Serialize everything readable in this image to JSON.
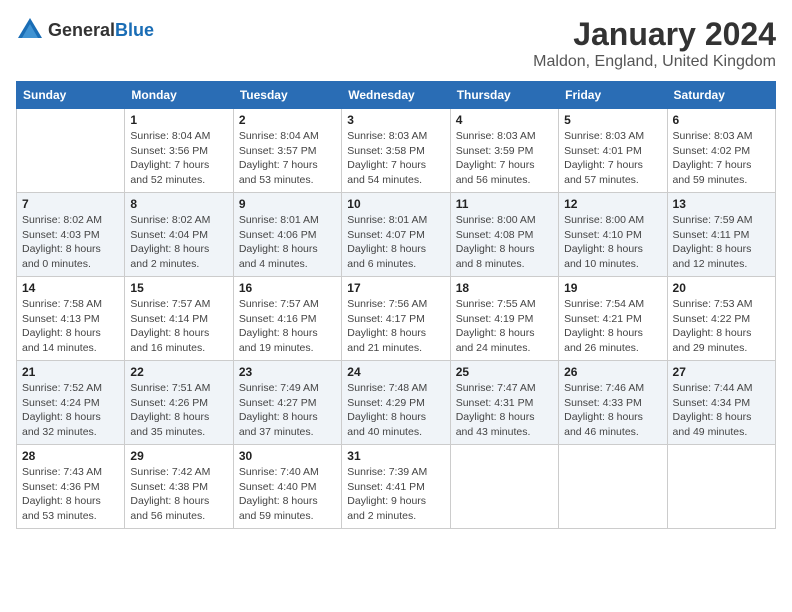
{
  "logo": {
    "general": "General",
    "blue": "Blue"
  },
  "title": "January 2024",
  "location": "Maldon, England, United Kingdom",
  "headers": [
    "Sunday",
    "Monday",
    "Tuesday",
    "Wednesday",
    "Thursday",
    "Friday",
    "Saturday"
  ],
  "rows": [
    {
      "shaded": false,
      "cells": [
        {
          "day": "",
          "lines": []
        },
        {
          "day": "1",
          "lines": [
            "Sunrise: 8:04 AM",
            "Sunset: 3:56 PM",
            "Daylight: 7 hours",
            "and 52 minutes."
          ]
        },
        {
          "day": "2",
          "lines": [
            "Sunrise: 8:04 AM",
            "Sunset: 3:57 PM",
            "Daylight: 7 hours",
            "and 53 minutes."
          ]
        },
        {
          "day": "3",
          "lines": [
            "Sunrise: 8:03 AM",
            "Sunset: 3:58 PM",
            "Daylight: 7 hours",
            "and 54 minutes."
          ]
        },
        {
          "day": "4",
          "lines": [
            "Sunrise: 8:03 AM",
            "Sunset: 3:59 PM",
            "Daylight: 7 hours",
            "and 56 minutes."
          ]
        },
        {
          "day": "5",
          "lines": [
            "Sunrise: 8:03 AM",
            "Sunset: 4:01 PM",
            "Daylight: 7 hours",
            "and 57 minutes."
          ]
        },
        {
          "day": "6",
          "lines": [
            "Sunrise: 8:03 AM",
            "Sunset: 4:02 PM",
            "Daylight: 7 hours",
            "and 59 minutes."
          ]
        }
      ]
    },
    {
      "shaded": true,
      "cells": [
        {
          "day": "7",
          "lines": [
            "Sunrise: 8:02 AM",
            "Sunset: 4:03 PM",
            "Daylight: 8 hours",
            "and 0 minutes."
          ]
        },
        {
          "day": "8",
          "lines": [
            "Sunrise: 8:02 AM",
            "Sunset: 4:04 PM",
            "Daylight: 8 hours",
            "and 2 minutes."
          ]
        },
        {
          "day": "9",
          "lines": [
            "Sunrise: 8:01 AM",
            "Sunset: 4:06 PM",
            "Daylight: 8 hours",
            "and 4 minutes."
          ]
        },
        {
          "day": "10",
          "lines": [
            "Sunrise: 8:01 AM",
            "Sunset: 4:07 PM",
            "Daylight: 8 hours",
            "and 6 minutes."
          ]
        },
        {
          "day": "11",
          "lines": [
            "Sunrise: 8:00 AM",
            "Sunset: 4:08 PM",
            "Daylight: 8 hours",
            "and 8 minutes."
          ]
        },
        {
          "day": "12",
          "lines": [
            "Sunrise: 8:00 AM",
            "Sunset: 4:10 PM",
            "Daylight: 8 hours",
            "and 10 minutes."
          ]
        },
        {
          "day": "13",
          "lines": [
            "Sunrise: 7:59 AM",
            "Sunset: 4:11 PM",
            "Daylight: 8 hours",
            "and 12 minutes."
          ]
        }
      ]
    },
    {
      "shaded": false,
      "cells": [
        {
          "day": "14",
          "lines": [
            "Sunrise: 7:58 AM",
            "Sunset: 4:13 PM",
            "Daylight: 8 hours",
            "and 14 minutes."
          ]
        },
        {
          "day": "15",
          "lines": [
            "Sunrise: 7:57 AM",
            "Sunset: 4:14 PM",
            "Daylight: 8 hours",
            "and 16 minutes."
          ]
        },
        {
          "day": "16",
          "lines": [
            "Sunrise: 7:57 AM",
            "Sunset: 4:16 PM",
            "Daylight: 8 hours",
            "and 19 minutes."
          ]
        },
        {
          "day": "17",
          "lines": [
            "Sunrise: 7:56 AM",
            "Sunset: 4:17 PM",
            "Daylight: 8 hours",
            "and 21 minutes."
          ]
        },
        {
          "day": "18",
          "lines": [
            "Sunrise: 7:55 AM",
            "Sunset: 4:19 PM",
            "Daylight: 8 hours",
            "and 24 minutes."
          ]
        },
        {
          "day": "19",
          "lines": [
            "Sunrise: 7:54 AM",
            "Sunset: 4:21 PM",
            "Daylight: 8 hours",
            "and 26 minutes."
          ]
        },
        {
          "day": "20",
          "lines": [
            "Sunrise: 7:53 AM",
            "Sunset: 4:22 PM",
            "Daylight: 8 hours",
            "and 29 minutes."
          ]
        }
      ]
    },
    {
      "shaded": true,
      "cells": [
        {
          "day": "21",
          "lines": [
            "Sunrise: 7:52 AM",
            "Sunset: 4:24 PM",
            "Daylight: 8 hours",
            "and 32 minutes."
          ]
        },
        {
          "day": "22",
          "lines": [
            "Sunrise: 7:51 AM",
            "Sunset: 4:26 PM",
            "Daylight: 8 hours",
            "and 35 minutes."
          ]
        },
        {
          "day": "23",
          "lines": [
            "Sunrise: 7:49 AM",
            "Sunset: 4:27 PM",
            "Daylight: 8 hours",
            "and 37 minutes."
          ]
        },
        {
          "day": "24",
          "lines": [
            "Sunrise: 7:48 AM",
            "Sunset: 4:29 PM",
            "Daylight: 8 hours",
            "and 40 minutes."
          ]
        },
        {
          "day": "25",
          "lines": [
            "Sunrise: 7:47 AM",
            "Sunset: 4:31 PM",
            "Daylight: 8 hours",
            "and 43 minutes."
          ]
        },
        {
          "day": "26",
          "lines": [
            "Sunrise: 7:46 AM",
            "Sunset: 4:33 PM",
            "Daylight: 8 hours",
            "and 46 minutes."
          ]
        },
        {
          "day": "27",
          "lines": [
            "Sunrise: 7:44 AM",
            "Sunset: 4:34 PM",
            "Daylight: 8 hours",
            "and 49 minutes."
          ]
        }
      ]
    },
    {
      "shaded": false,
      "cells": [
        {
          "day": "28",
          "lines": [
            "Sunrise: 7:43 AM",
            "Sunset: 4:36 PM",
            "Daylight: 8 hours",
            "and 53 minutes."
          ]
        },
        {
          "day": "29",
          "lines": [
            "Sunrise: 7:42 AM",
            "Sunset: 4:38 PM",
            "Daylight: 8 hours",
            "and 56 minutes."
          ]
        },
        {
          "day": "30",
          "lines": [
            "Sunrise: 7:40 AM",
            "Sunset: 4:40 PM",
            "Daylight: 8 hours",
            "and 59 minutes."
          ]
        },
        {
          "day": "31",
          "lines": [
            "Sunrise: 7:39 AM",
            "Sunset: 4:41 PM",
            "Daylight: 9 hours",
            "and 2 minutes."
          ]
        },
        {
          "day": "",
          "lines": []
        },
        {
          "day": "",
          "lines": []
        },
        {
          "day": "",
          "lines": []
        }
      ]
    }
  ]
}
